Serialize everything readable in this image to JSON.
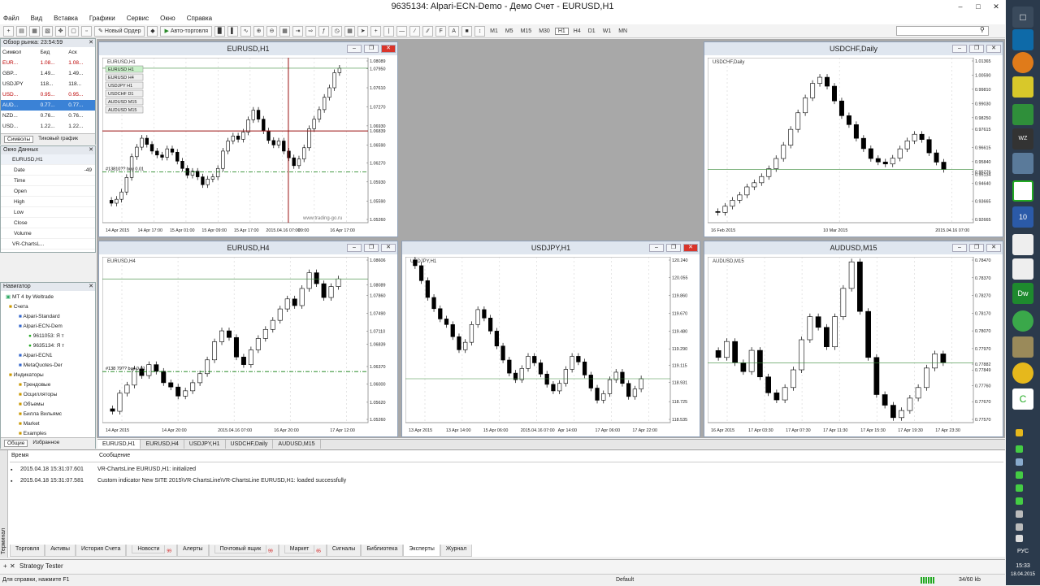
{
  "app": {
    "title": "9635134: Alpari-ECN-Demo - Демо Счет - EURUSD,H1"
  },
  "menu": [
    "Файл",
    "Вид",
    "Вставка",
    "Графики",
    "Сервис",
    "Окно",
    "Справка"
  ],
  "toolbar": {
    "new_order": "Новый Ордер",
    "autotrading": "Авто-торговля",
    "timeframes": [
      "M1",
      "M5",
      "M15",
      "M30",
      "H1",
      "H4",
      "D1",
      "W1",
      "MN"
    ]
  },
  "market_watch": {
    "title": "Обзор рынка: 23:54:59",
    "headers": [
      "Символ",
      "Бид",
      "Аск"
    ],
    "rows": [
      {
        "sym": "EUR...",
        "bid": "1.08...",
        "ask": "1.08..."
      },
      {
        "sym": "GBP...",
        "bid": "1.49...",
        "ask": "1.49..."
      },
      {
        "sym": "USDJPY",
        "bid": "118...",
        "ask": "118..."
      },
      {
        "sym": "USD...",
        "bid": "0.95...",
        "ask": "0.95..."
      },
      {
        "sym": "AUD...",
        "bid": "0.77...",
        "ask": "0.77..."
      },
      {
        "sym": "NZD...",
        "bid": "0.76...",
        "ask": "0.76..."
      },
      {
        "sym": "USD...",
        "bid": "1.22...",
        "ask": "1.22..."
      }
    ],
    "tabs": [
      "Символы",
      "Тиковый график"
    ]
  },
  "data_window": {
    "title": "Окно Данных",
    "symbol": "EURUSD,H1",
    "fields": [
      {
        "k": "Date",
        "v": "-49"
      },
      {
        "k": "Time",
        "v": ""
      },
      {
        "k": "Open",
        "v": ""
      },
      {
        "k": "High",
        "v": ""
      },
      {
        "k": "Low",
        "v": ""
      },
      {
        "k": "Close",
        "v": ""
      },
      {
        "k": "Volume",
        "v": ""
      }
    ],
    "indicator": "VR-ChartsL..."
  },
  "navigator": {
    "title": "Навигатор",
    "items": [
      "MT 4 by Weltrade",
      "Счета",
      "Alpari-Standard",
      "Alpari-ECN-Dem",
      "9611053: Я т",
      "9635134: Я т",
      "Alpari-ECN1",
      "MetaQuotes-Der",
      "Индикаторы",
      "Трендовые",
      "Осцилляторы",
      "Объемы",
      "Билла Вильямс",
      "Market",
      "Examples"
    ],
    "tabs": [
      "Общие",
      "Избранное"
    ]
  },
  "charts": [
    {
      "title": "EURUSD,H1",
      "label": "EURUSD,H1",
      "prices": [
        "1.08089",
        "1.07950",
        "1.07610",
        "1.07270",
        "1.06930",
        "1.06839",
        "1.06590",
        "1.06270",
        "1.05930",
        "1.05590",
        "1.05260"
      ],
      "times": [
        "14 Apr 2015",
        "14 Apr 17:00",
        "15 Apr 01:00",
        "15 Apr 09:00",
        "15 Apr 17:00",
        "2015.04.16 07:00",
        "09:00",
        "16 Apr 17:00"
      ],
      "legend": [
        "EURUSD H1",
        "EURUSD H4",
        "USDJPY H1",
        "USDCHF D1",
        "AUDUSD M15",
        "AUDUSD M15"
      ],
      "order": "#13810?? buy 0.01",
      "watermark": "www.trading-go.ru",
      "closes": [
        1.0555,
        1.0562,
        1.0575,
        1.0601,
        1.0638,
        1.0655,
        1.0671,
        1.066,
        1.0648,
        1.0641,
        1.0637,
        1.0652,
        1.0646,
        1.063,
        1.0617,
        1.0605,
        1.0612,
        1.0602,
        1.0588,
        1.0598,
        1.0602,
        1.0617,
        1.0648,
        1.0666,
        1.0675,
        1.0669,
        1.0682,
        1.0704,
        1.0721,
        1.0705,
        1.0684,
        1.0667,
        1.0659,
        1.0666,
        1.0648,
        1.0636,
        1.0622,
        1.0634,
        1.0654,
        1.0688,
        1.0705,
        1.0722,
        1.0744,
        1.0761,
        1.0788,
        1.0796
      ]
    },
    {
      "title": "USDCHF,Daily",
      "label": "USDCHF,Daily",
      "prices": [
        "1.01365",
        "1.00590",
        "0.99810",
        "0.99030",
        "0.98250",
        "0.97615",
        "0.96615",
        "0.95840",
        "0.95276",
        "0.95134",
        "0.94640",
        "0.93665",
        "0.92665"
      ],
      "times": [
        "16 Feb 2015",
        "10 Mar 2015",
        "2015.04.16 07:00"
      ],
      "closes": [
        0.9305,
        0.9339,
        0.9372,
        0.9401,
        0.9445,
        0.9468,
        0.9502,
        0.9545,
        0.9601,
        0.9674,
        0.9761,
        0.9852,
        0.9934,
        1.0013,
        1.0047,
        0.9998,
        0.9917,
        0.9836,
        0.9787,
        0.9712,
        0.9655,
        0.9601,
        0.9582,
        0.9571,
        0.9603,
        0.9654,
        0.9698,
        0.9734,
        0.9705,
        0.9632,
        0.9581,
        0.9541
      ]
    },
    {
      "title": "EURUSD,H4",
      "label": "EURUSD,H4",
      "prices": [
        "1.08606",
        "1.08089",
        "1.07860",
        "1.07490",
        "1.07110",
        "1.06839",
        "1.06370",
        "1.06000",
        "1.05620",
        "1.05260"
      ],
      "times": [
        "14 Apr 2015",
        "14 Apr 20:00",
        "2015.04.16 07:00",
        "16 Apr 20:00",
        "17 Apr 12:00"
      ],
      "order": "#138 79?? buy 0.01",
      "closes": [
        1.0543,
        1.0581,
        1.0598,
        1.0632,
        1.0618,
        1.0641,
        1.0627,
        1.0603,
        1.0594,
        1.0575,
        1.0586,
        1.0603,
        1.0622,
        1.0651,
        1.0689,
        1.0712,
        1.0698,
        1.0657,
        1.0641,
        1.0672,
        1.0696,
        1.0715,
        1.0734,
        1.0758,
        1.0779,
        1.0765,
        1.0801,
        1.0834,
        1.0811,
        1.0782,
        1.0805,
        1.0821
      ]
    },
    {
      "title": "USDJPY,H1",
      "label": "USDJPY,H1",
      "prices": [
        "120.240",
        "120.055",
        "119.860",
        "119.670",
        "119.480",
        "119.290",
        "119.115",
        "118.931",
        "118.725",
        "118.535"
      ],
      "times": [
        "13 Apr 2015",
        "13 Apr 14:00",
        "15 Apr 06:00",
        "2015.04.16 07:00",
        "Apr 14:00",
        "17 Apr 06:00",
        "17 Apr 22:00"
      ],
      "closes": [
        120.18,
        120.02,
        119.84,
        119.72,
        119.61,
        119.55,
        119.42,
        119.28,
        119.36,
        119.55,
        119.71,
        119.62,
        119.48,
        119.32,
        119.17,
        119.03,
        118.96,
        119.08,
        119.21,
        119.14,
        119.02,
        118.91,
        118.84,
        118.92,
        119.07,
        119.21,
        119.15,
        119.01,
        118.87,
        118.74,
        118.81,
        118.96,
        119.04,
        118.92,
        118.78,
        118.86,
        118.97
      ]
    },
    {
      "title": "AUDUSD,M15",
      "label": "AUDUSD,M15",
      "prices": [
        "0.78470",
        "0.78370",
        "0.78270",
        "0.78170",
        "0.78070",
        "0.77970",
        "0.77882",
        "0.77849",
        "0.77760",
        "0.77670",
        "0.77570"
      ],
      "times": [
        "16 Apr 2015",
        "17 Apr 03:30",
        "17 Apr 07:30",
        "17 Apr 11:30",
        "17 Apr 15:30",
        "17 Apr 19:30",
        "17 Apr 23:30"
      ],
      "closes": [
        0.7792,
        0.7801,
        0.7789,
        0.7784,
        0.7796,
        0.7781,
        0.7772,
        0.7768,
        0.7775,
        0.7785,
        0.7802,
        0.7815,
        0.7809,
        0.7798,
        0.7815,
        0.7831,
        0.7846,
        0.7818,
        0.7792,
        0.7771,
        0.7765,
        0.7758,
        0.7762,
        0.7769,
        0.7775,
        0.7786,
        0.7794,
        0.7789
      ]
    }
  ],
  "chart_tabs": [
    "EURUSD,H1",
    "EURUSD,H4",
    "USDJPY,H1",
    "USDCHF,Daily",
    "AUDUSD,M15"
  ],
  "terminal": {
    "side_label": "Терминал",
    "headers": [
      "Время",
      "Сообщение"
    ],
    "rows": [
      {
        "time": "2015.04.18 15:31:07.601",
        "msg": "VR-ChartsLine EURUSD,H1: initialized"
      },
      {
        "time": "2015.04.18 15:31:07.581",
        "msg": "Custom indicator New SITE 2015\\VR-ChartsLine\\VR-ChartsLine EURUSD,H1: loaded successfully"
      }
    ],
    "tabs": [
      "Торговля",
      "Активы",
      "История Счета",
      "Новости",
      "Алерты",
      "Почтовый ящик",
      "Маркет",
      "Сигналы",
      "Библиотека",
      "Эксперты",
      "Журнал"
    ],
    "badges": {
      "Новости": "99",
      "Почтовый ящик": "99",
      "Маркет": "65"
    }
  },
  "strategy_tester": "Strategy Tester",
  "statusbar": {
    "help": "Для справки, нажмите F1",
    "profile": "Default",
    "traffic": "34/60 kb"
  },
  "taskbar": {
    "lang": "РУС",
    "time": "15:33",
    "date": "18.04.2015"
  },
  "colors": {
    "bull": "#ffffff",
    "bear": "#000000",
    "accent": "#3b82d6",
    "close_btn": "#d9342b"
  }
}
